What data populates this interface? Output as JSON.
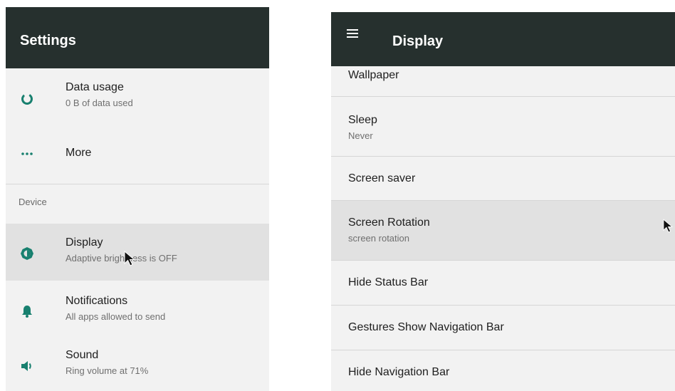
{
  "left": {
    "title": "Settings",
    "items": [
      {
        "title": "Data usage",
        "subtitle": "0 B of data used",
        "icon": "data-usage-icon"
      },
      {
        "title": "More",
        "subtitle": "",
        "icon": "more-dots-icon"
      }
    ],
    "section_label": "Device",
    "device_items": [
      {
        "title": "Display",
        "subtitle": "Adaptive brightness is OFF",
        "icon": "brightness-icon"
      },
      {
        "title": "Notifications",
        "subtitle": "All apps allowed to send",
        "icon": "bell-icon"
      },
      {
        "title": "Sound",
        "subtitle": "Ring volume at 71%",
        "icon": "volume-icon"
      }
    ]
  },
  "right": {
    "title": "Display",
    "items": [
      {
        "title": "Wallpaper",
        "subtitle": ""
      },
      {
        "title": "Sleep",
        "subtitle": "Never"
      },
      {
        "title": "Screen saver",
        "subtitle": ""
      },
      {
        "title": "Screen Rotation",
        "subtitle": "screen rotation"
      },
      {
        "title": "Hide Status Bar",
        "subtitle": ""
      },
      {
        "title": "Gestures Show Navigation Bar",
        "subtitle": ""
      },
      {
        "title": "Hide Navigation Bar",
        "subtitle": ""
      }
    ]
  },
  "colors": {
    "appbar": "#26302e",
    "accent_icon": "#18806f",
    "highlight_row": "#e1e1e1",
    "background": "#f2f2f2"
  }
}
